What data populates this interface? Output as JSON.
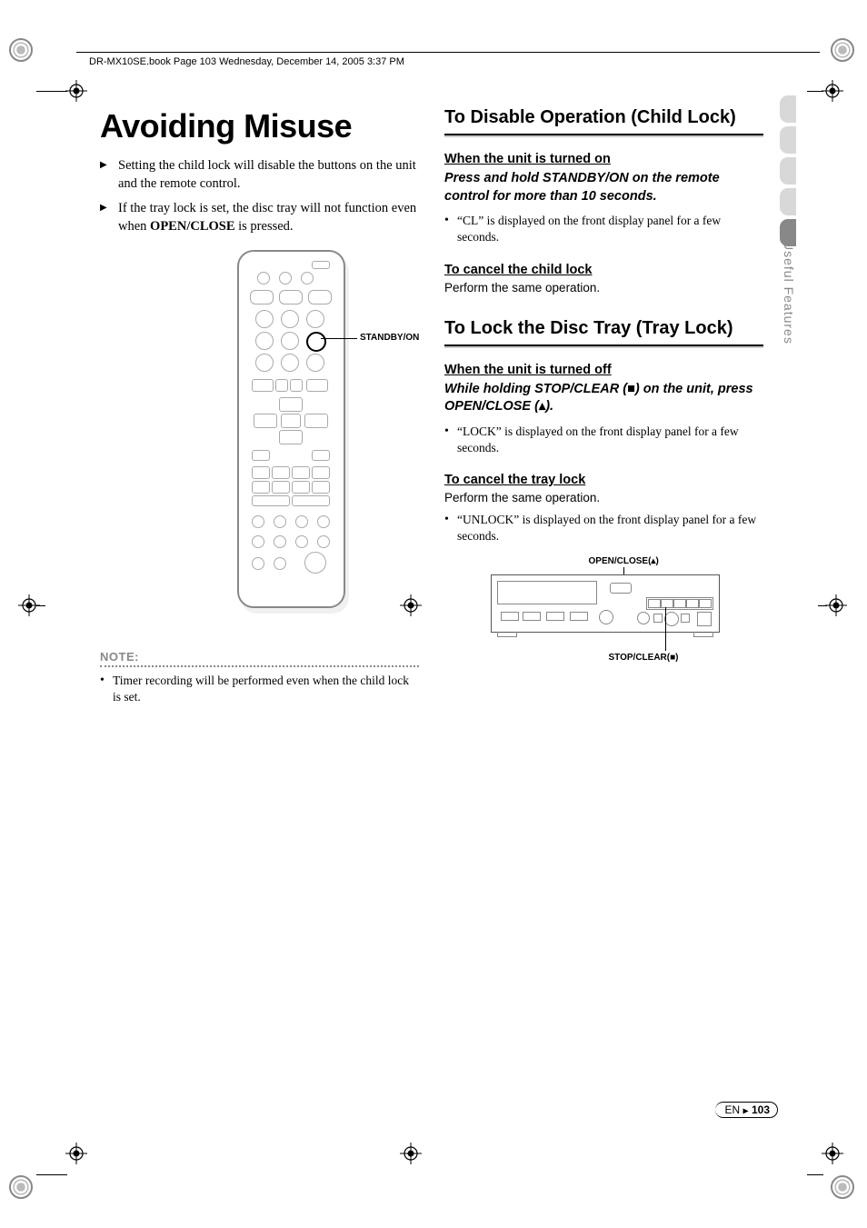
{
  "header": {
    "meta_line": "DR-MX10SE.book  Page 103  Wednesday, December 14, 2005  3:37 PM"
  },
  "left": {
    "title": "Avoiding Misuse",
    "bullets": [
      "Setting the child lock will disable the buttons on the unit and the remote control.",
      "If the tray lock is set, the disc tray will not function even when "
    ],
    "bullet2_strong": "OPEN/CLOSE",
    "bullet2_tail": " is pressed.",
    "remote_label": "STANDBY/ON",
    "note_label": "NOTE:",
    "note_item": "Timer recording will be performed even when the child lock is set."
  },
  "right": {
    "sec1_title": "To Disable Operation (Child Lock)",
    "sec1_h3a": "When the unit is turned on",
    "sec1_instr": "Press and hold STANDBY/ON on the remote control for more than 10 seconds.",
    "sec1_bullet": "“CL” is displayed on the front display panel for a few seconds.",
    "sec1_h3b": "To cancel the child lock",
    "sec1_body": "Perform the same operation.",
    "sec2_title": "To Lock the Disc Tray (Tray Lock)",
    "sec2_h3a": "When the unit is turned off",
    "sec2_instr_a": "While holding STOP/CLEAR (",
    "sec2_instr_b": ") on the unit, press OPEN/CLOSE (",
    "sec2_instr_c": ").",
    "sec2_bullet1": "“LOCK” is displayed on the front display panel for a few seconds.",
    "sec2_h3b": "To cancel the tray lock",
    "sec2_body": "Perform the same operation.",
    "sec2_bullet2": "“UNLOCK” is displayed on the front display panel for a few seconds.",
    "unit_label_open": "OPEN/CLOSE(",
    "unit_label_open_tail": ")",
    "unit_label_stop": "STOP/CLEAR(",
    "unit_label_stop_tail": ")"
  },
  "side": {
    "section_label": "Useful Features"
  },
  "footer": {
    "lang": "EN",
    "page": "103"
  },
  "icons": {
    "stop_glyph": "■",
    "eject_glyph": "▴",
    "tri_glyph": "▶"
  }
}
